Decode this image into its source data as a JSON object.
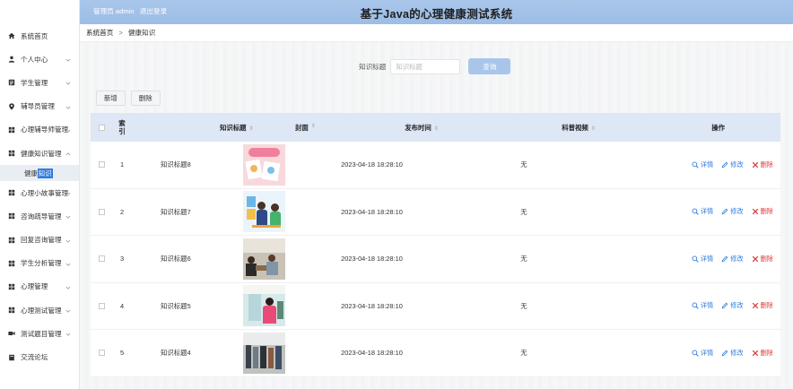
{
  "app": {
    "title": "基于Java的心理健康测试系统",
    "user_label": "管理员 admin",
    "logout_label": "退出登录"
  },
  "sidebar": {
    "items": [
      {
        "label": "系统首页",
        "icon": "home-icon",
        "arrow": false
      },
      {
        "label": "个人中心",
        "icon": "user-icon",
        "arrow": true
      },
      {
        "label": "学生管理",
        "icon": "list-icon",
        "arrow": true
      },
      {
        "label": "辅导员管理",
        "icon": "pin-icon",
        "arrow": true
      },
      {
        "label": "心理辅导师管理",
        "icon": "grid-icon",
        "arrow": true
      },
      {
        "label": "健康知识管理",
        "icon": "grid-icon",
        "arrow": true,
        "expanded": true
      },
      {
        "label": "心理小故事管理",
        "icon": "grid-icon",
        "arrow": true
      },
      {
        "label": "咨询疏导管理",
        "icon": "grid-icon",
        "arrow": true
      },
      {
        "label": "回复咨询管理",
        "icon": "grid-icon",
        "arrow": true
      },
      {
        "label": "学生分析管理",
        "icon": "grid-icon",
        "arrow": true
      },
      {
        "label": "心理管理",
        "icon": "grid-icon",
        "arrow": true
      },
      {
        "label": "心理测试管理",
        "icon": "grid-icon",
        "arrow": true
      },
      {
        "label": "测试题目管理",
        "icon": "video-icon",
        "arrow": true
      },
      {
        "label": "交流论坛",
        "icon": "book-icon",
        "arrow": false
      }
    ],
    "sub_item_prefix": "健康",
    "sub_item_highlight": "知识"
  },
  "breadcrumb": {
    "home": "系统首页",
    "separator": ">",
    "current": "健康知识"
  },
  "search": {
    "label": "知识标题",
    "placeholder": "知识标题",
    "button": "查询"
  },
  "toolbar": {
    "add": "新增",
    "delete": "删除"
  },
  "table": {
    "headers": {
      "index_top": "索",
      "index_bottom": "引",
      "title": "知识标题",
      "cover": "封面",
      "time": "发布时间",
      "video": "科普视频",
      "actions": "操作"
    },
    "rows": [
      {
        "index": "1",
        "title": "知识标题8",
        "time": "2023-04-18 18:28:10",
        "video": "无"
      },
      {
        "index": "2",
        "title": "知识标题7",
        "time": "2023-04-18 18:28:10",
        "video": "无"
      },
      {
        "index": "3",
        "title": "知识标题6",
        "time": "2023-04-18 18:28:10",
        "video": "无"
      },
      {
        "index": "4",
        "title": "知识标题5",
        "time": "2023-04-18 18:28:10",
        "video": "无"
      },
      {
        "index": "5",
        "title": "知识标题4",
        "time": "2023-04-18 18:28:10",
        "video": "无"
      }
    ],
    "action_labels": {
      "view": "详情",
      "edit": "修改",
      "delete": "删除"
    }
  },
  "colors": {
    "header_bg": "#a9c6ea",
    "table_head_bg": "#dde7f5",
    "link_blue": "#2f7be0",
    "danger_red": "#e23b3b"
  }
}
